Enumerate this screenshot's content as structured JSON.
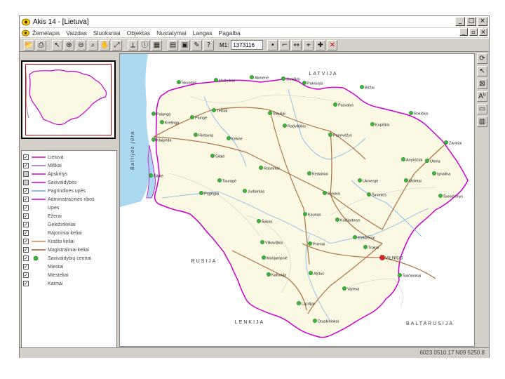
{
  "window": {
    "title": "Akis 14 - [Lietuva]"
  },
  "menu": [
    "Žemėlapis",
    "Vaizdas",
    "Sluoksniai",
    "Objektas",
    "Nustatymai",
    "Langas",
    "Pagalba"
  ],
  "toolbar": {
    "scale_label": "M1:",
    "scale_value": "1373116"
  },
  "legend": {
    "layers": [
      {
        "label": "Lietuva",
        "checked": true,
        "symbol": "line",
        "color": "#cc00cc"
      },
      {
        "label": "Miškai",
        "checked": true,
        "symbol": "line",
        "color": "#9966cc"
      },
      {
        "label": "Apskritys",
        "checked": false,
        "symbol": "line",
        "color": "#cc00cc"
      },
      {
        "label": "Savivaldybės",
        "checked": false,
        "symbol": "line",
        "color": "#cc00cc"
      },
      {
        "label": "Pagrindinės upės",
        "checked": true,
        "symbol": "line",
        "color": "#66aaff"
      },
      {
        "label": "Administracinės ribos",
        "checked": true,
        "symbol": "line",
        "color": "#cc00cc"
      },
      {
        "label": "Upės",
        "checked": true,
        "symbol": "none",
        "color": "#66aaff"
      },
      {
        "label": "Ežerai",
        "checked": true,
        "symbol": "none",
        "color": "#66aaff"
      },
      {
        "label": "Geležinkeliai",
        "checked": true,
        "symbol": "none",
        "color": "#000000"
      },
      {
        "label": "Rajoniniai keliai",
        "checked": true,
        "symbol": "none",
        "color": "#aaaaaa"
      },
      {
        "label": "Krašto keliai",
        "checked": true,
        "symbol": "line",
        "color": "#cc8844"
      },
      {
        "label": "Magistraliniai keliai",
        "checked": true,
        "symbol": "line",
        "color": "#aa5522"
      },
      {
        "label": "Savivaldybių centrai",
        "checked": true,
        "symbol": "dot",
        "color": "#33bb33"
      },
      {
        "label": "Miestai",
        "checked": true,
        "symbol": "none",
        "color": "#33bb33"
      },
      {
        "label": "Miesteliai",
        "checked": true,
        "symbol": "none",
        "color": "#33bb33"
      },
      {
        "label": "Kaimai",
        "checked": true,
        "symbol": "none",
        "color": "#33bb33"
      }
    ]
  },
  "map": {
    "labels": {
      "latvia": "LATVIJA",
      "sea": "Baltijos jūra",
      "russia": "RUSIJA",
      "poland": "LENKIJA",
      "belarus": "BALTARUSIJA"
    },
    "cities": [
      {
        "name": "Skuodas"
      },
      {
        "name": "Mažeikiai"
      },
      {
        "name": "Akmenė"
      },
      {
        "name": "Joniškis"
      },
      {
        "name": "Pakruojis"
      },
      {
        "name": "Biržai"
      },
      {
        "name": "Palanga"
      },
      {
        "name": "Kretinga"
      },
      {
        "name": "Plungė"
      },
      {
        "name": "Telšiai"
      },
      {
        "name": "Šiauliai"
      },
      {
        "name": "Pasvalys"
      },
      {
        "name": "Rokiškis"
      },
      {
        "name": "Radviliškis"
      },
      {
        "name": "Kupiškis"
      },
      {
        "name": "Klaipėda"
      },
      {
        "name": "Rietavas"
      },
      {
        "name": "Kelmė"
      },
      {
        "name": "Panevėžys"
      },
      {
        "name": "Zarasai"
      },
      {
        "name": "Šilalė"
      },
      {
        "name": "Raseiniai"
      },
      {
        "name": "Anykščiai"
      },
      {
        "name": "Utena"
      },
      {
        "name": "Šilutė"
      },
      {
        "name": "Tauragė"
      },
      {
        "name": "Kėdainiai"
      },
      {
        "name": "Ukmergė"
      },
      {
        "name": "Molėtai"
      },
      {
        "name": "Ignalina"
      },
      {
        "name": "Pagėgiai"
      },
      {
        "name": "Jurbarkas"
      },
      {
        "name": "Jonava"
      },
      {
        "name": "Širvintos"
      },
      {
        "name": "Švenčionys"
      },
      {
        "name": "Kaunas"
      },
      {
        "name": "Kaišiadorys"
      },
      {
        "name": "Šakiai"
      },
      {
        "name": "Vilkaviškis"
      },
      {
        "name": "Marijampolė"
      },
      {
        "name": "Prienai"
      },
      {
        "name": "Elektrėnai"
      },
      {
        "name": "Trakai"
      },
      {
        "name": "VILNIUS"
      },
      {
        "name": "Kalvarija"
      },
      {
        "name": "Alytus"
      },
      {
        "name": "Lazdijai"
      },
      {
        "name": "Varėna"
      },
      {
        "name": "Šalčininkai"
      },
      {
        "name": "Druskininkai"
      }
    ]
  },
  "statusbar": {
    "coords": "6023 0510.17  N09 5250.8"
  },
  "colors": {
    "land": "#fbf8e4",
    "sea": "#aad8ee",
    "border": "#cc00cc",
    "road": "#b07040",
    "city": "#33bb33",
    "capital": "#dd2222"
  }
}
